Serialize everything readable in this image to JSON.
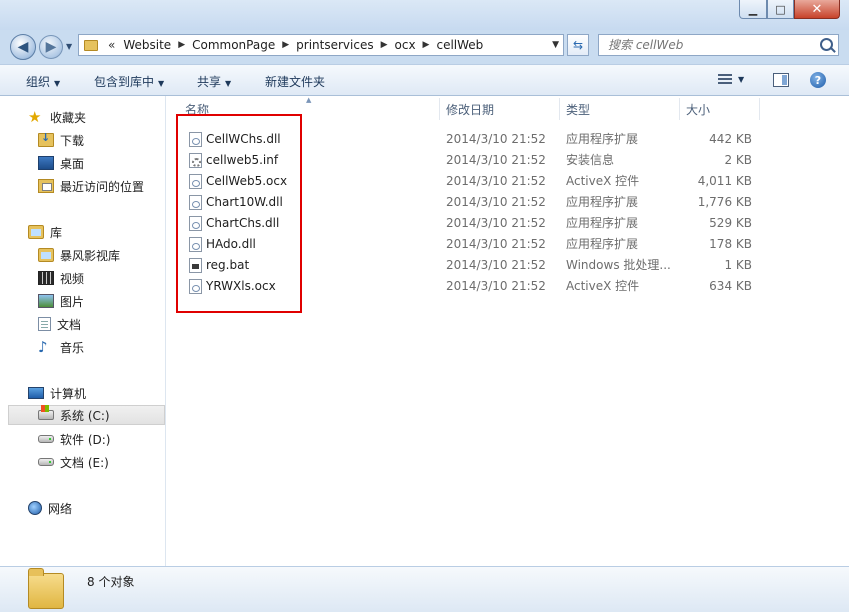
{
  "window": {
    "controls": {
      "minimize": "▁",
      "maximize": "□",
      "close": "✕"
    }
  },
  "address": {
    "overflow": "«",
    "crumbs": [
      "Website",
      "CommonPage",
      "printservices",
      "ocx",
      "cellWeb"
    ],
    "search_placeholder": "搜索 cellWeb"
  },
  "toolbar": {
    "organize": "组织",
    "include_in_library": "包含到库中",
    "share": "共享",
    "new_folder": "新建文件夹"
  },
  "nav": {
    "favorites": "收藏夹",
    "downloads": "下载",
    "desktop": "桌面",
    "recent": "最近访问的位置",
    "libraries": "库",
    "storm_video": "暴风影视库",
    "videos": "视频",
    "pictures": "图片",
    "documents": "文档",
    "music": "音乐",
    "computer": "计算机",
    "drive_c": "系统 (C:)",
    "drive_d": "软件 (D:)",
    "drive_e": "文档 (E:)",
    "network": "网络"
  },
  "columns": {
    "name": "名称",
    "date": "修改日期",
    "type": "类型",
    "size": "大小"
  },
  "files": [
    {
      "name": "CellWChs.dll",
      "date": "2014/3/10 21:52",
      "type": "应用程序扩展",
      "size": "442 KB",
      "icon": "dll-icon"
    },
    {
      "name": "cellweb5.inf",
      "date": "2014/3/10 21:52",
      "type": "安装信息",
      "size": "2 KB",
      "icon": "inf-icon"
    },
    {
      "name": "CellWeb5.ocx",
      "date": "2014/3/10 21:52",
      "type": "ActiveX 控件",
      "size": "4,011 KB",
      "icon": "ocx-icon"
    },
    {
      "name": "Chart10W.dll",
      "date": "2014/3/10 21:52",
      "type": "应用程序扩展",
      "size": "1,776 KB",
      "icon": "dll-icon"
    },
    {
      "name": "ChartChs.dll",
      "date": "2014/3/10 21:52",
      "type": "应用程序扩展",
      "size": "529 KB",
      "icon": "dll-icon"
    },
    {
      "name": "HAdo.dll",
      "date": "2014/3/10 21:52",
      "type": "应用程序扩展",
      "size": "178 KB",
      "icon": "dll-icon"
    },
    {
      "name": "reg.bat",
      "date": "2014/3/10 21:52",
      "type": "Windows 批处理...",
      "size": "1 KB",
      "icon": "bat-icon"
    },
    {
      "name": "YRWXls.ocx",
      "date": "2014/3/10 21:52",
      "type": "ActiveX 控件",
      "size": "634 KB",
      "icon": "ocx-icon"
    }
  ],
  "status": {
    "item_count": "8 个对象"
  },
  "colors": {
    "highlight_box": "#e00000",
    "selection": "#e2e2e2"
  }
}
